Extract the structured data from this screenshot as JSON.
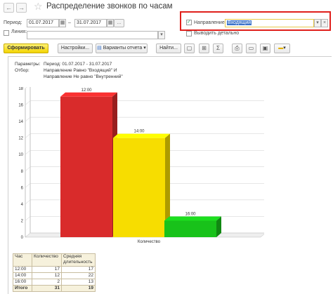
{
  "window": {
    "title": "Распределение звонков по часам",
    "back_icon": "←",
    "forward_icon": "→",
    "favorite_icon": "☆"
  },
  "filters": {
    "period_label": "Период:",
    "period_from": "01.07.2017",
    "period_dash": "–",
    "period_to": "31.07.2017",
    "period_more": "...",
    "line_label": "Линия:",
    "line_value": "",
    "direction_checked": true,
    "direction_label": "Направление:",
    "direction_value": "Входящий",
    "detail_checked": false,
    "detail_label": "Выводить детально"
  },
  "toolbar": {
    "generate": "Сформировать",
    "settings": "Настройки...",
    "variants": "Варианты отчета",
    "find": "Найти...",
    "dropdown_icon": "▾"
  },
  "report": {
    "params_label": "Параметры:",
    "params_value": "Период: 01.07.2017 - 31.07.2017",
    "filter_label": "Отбор:",
    "filter_line1": "Направление Равно \"Входящий\" И",
    "filter_line2": "Направление Не равно \"Внутренний\""
  },
  "chart_data": {
    "type": "bar",
    "categories": [
      "Количество"
    ],
    "series": [
      {
        "name": "12:00",
        "values": [
          17
        ],
        "color": "#d92b2b"
      },
      {
        "name": "14:00",
        "values": [
          12
        ],
        "color": "#f7dd00"
      },
      {
        "name": "16:00",
        "values": [
          2
        ],
        "color": "#18c21a"
      }
    ],
    "xlabel": "Количество",
    "ylabel": "",
    "ylim": [
      0,
      18
    ],
    "yticks": [
      0,
      2,
      4,
      6,
      8,
      10,
      12,
      14,
      16,
      18
    ],
    "grid": true
  },
  "table": {
    "headers": [
      "Час",
      "Количество",
      "Средняя длительность"
    ],
    "rows": [
      [
        "12:00",
        "17",
        "17"
      ],
      [
        "14:00",
        "12",
        "22"
      ],
      [
        "16:00",
        "2",
        "13"
      ]
    ],
    "total": [
      "Итого",
      "31",
      "19"
    ]
  }
}
